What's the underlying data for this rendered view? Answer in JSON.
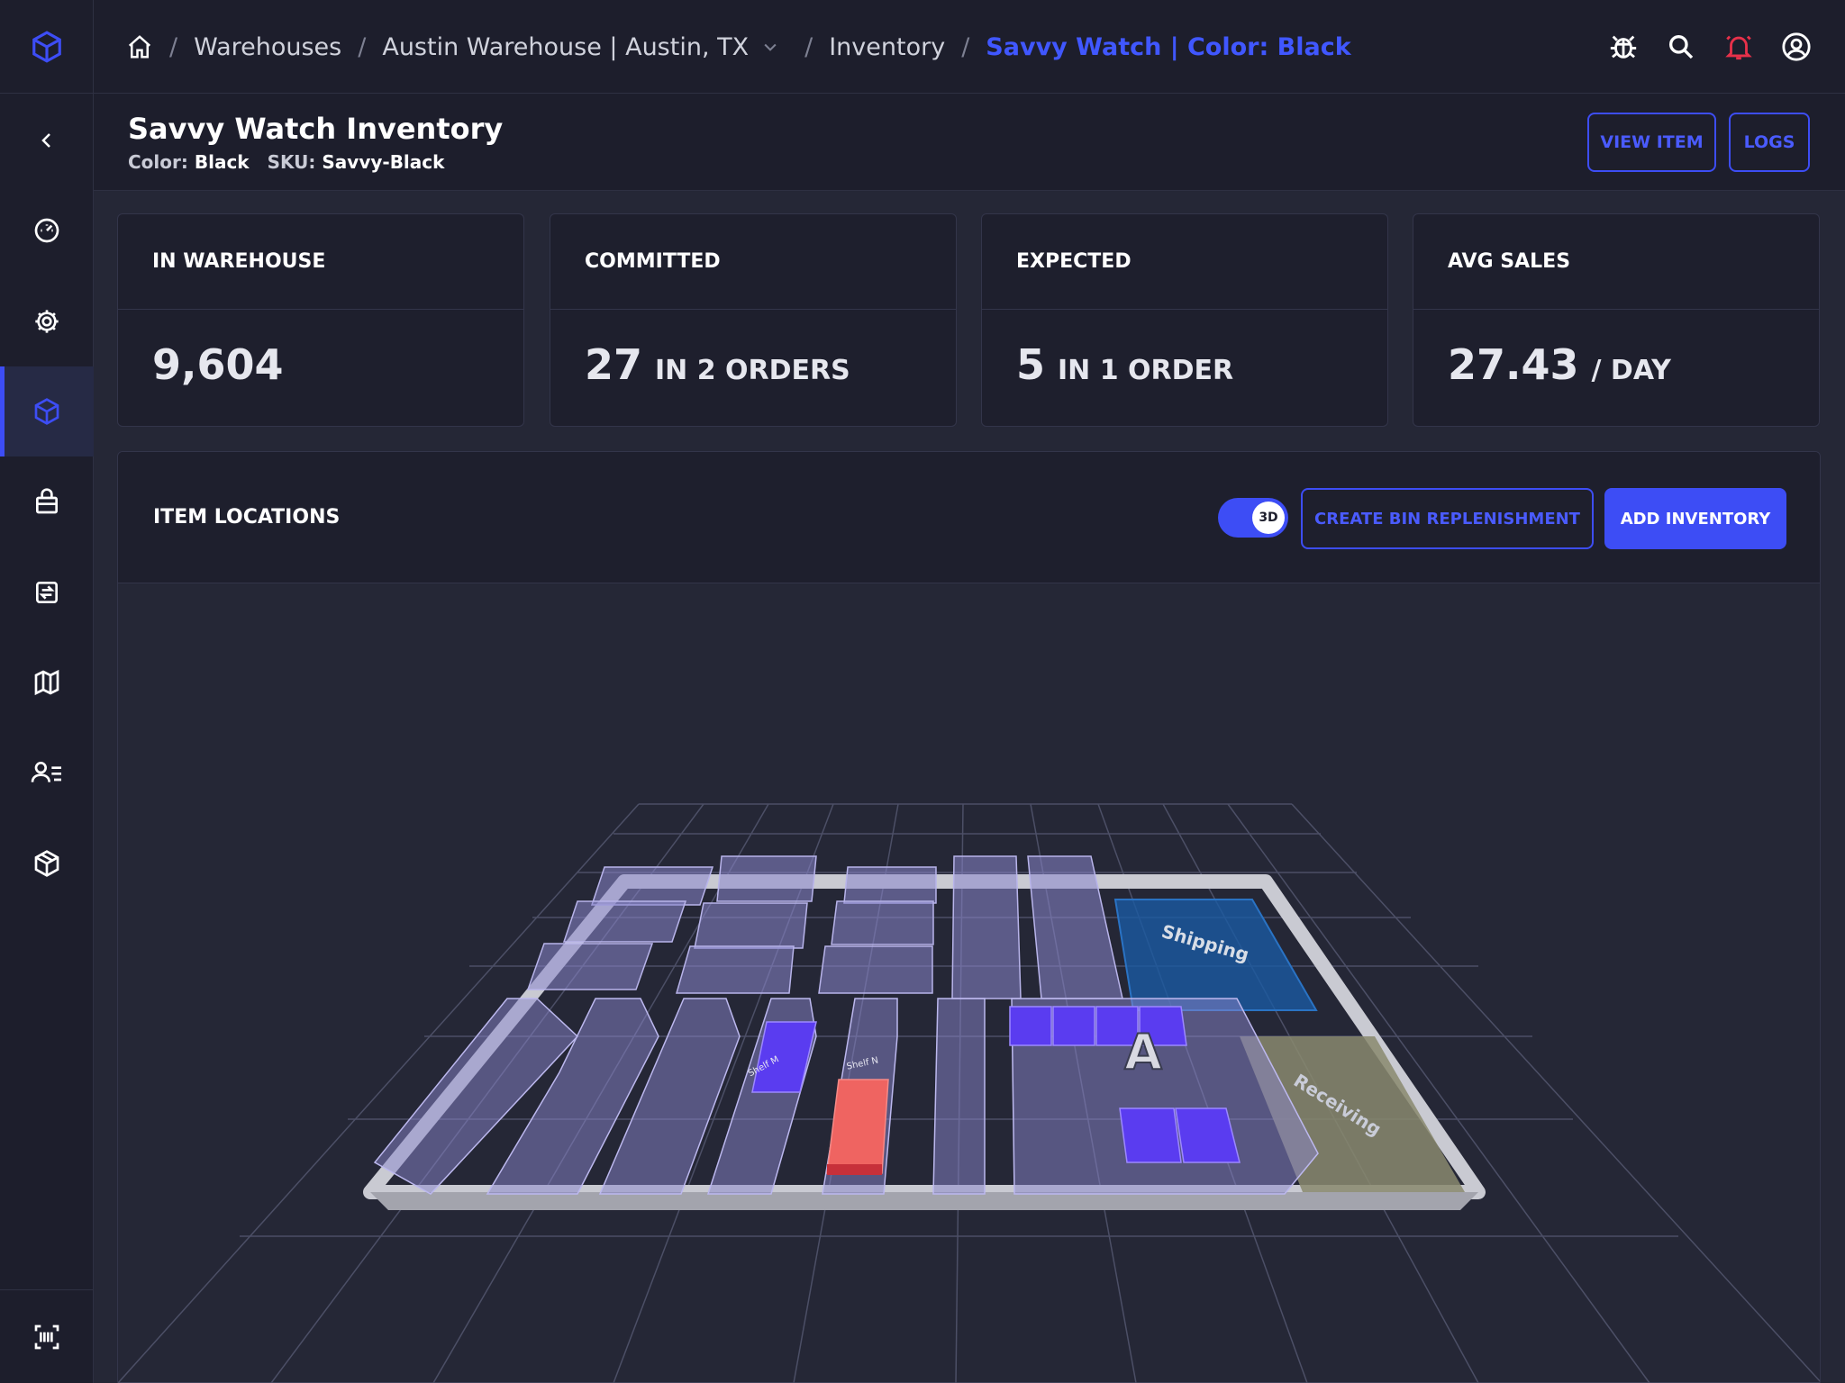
{
  "breadcrumb": {
    "items": [
      "Warehouses",
      "Austin Warehouse | Austin, TX",
      "Inventory"
    ],
    "current": "Savvy Watch | Color: Black"
  },
  "header": {
    "title": "Savvy Watch Inventory",
    "color_label": "Color:",
    "color_value": "Black",
    "sku_label": "SKU:",
    "sku_value": "Savvy-Black",
    "view_item_label": "VIEW ITEM",
    "logs_label": "LOGS"
  },
  "sidebar": {
    "items": [
      {
        "icon": "chevron-left-icon"
      },
      {
        "icon": "dashboard-gauge-icon"
      },
      {
        "icon": "gear-icon"
      },
      {
        "icon": "box-icon",
        "active": true
      },
      {
        "icon": "bag-icon"
      },
      {
        "icon": "transfer-icon"
      },
      {
        "icon": "map-icon"
      },
      {
        "icon": "user-list-icon"
      },
      {
        "icon": "package-icon"
      }
    ],
    "bottom_icon": "barcode-scan-icon"
  },
  "stats": [
    {
      "label": "IN WAREHOUSE",
      "value": "9,604",
      "unit": ""
    },
    {
      "label": "COMMITTED",
      "value": "27",
      "unit": "IN 2 ORDERS"
    },
    {
      "label": "EXPECTED",
      "value": "5",
      "unit": "IN 1 ORDER"
    },
    {
      "label": "AVG SALES",
      "value": "27.43",
      "unit": "/ DAY"
    }
  ],
  "locations": {
    "title": "ITEM LOCATIONS",
    "toggle_label": "3D",
    "toggle_on": true,
    "create_label": "CREATE BIN REPLENISHMENT",
    "add_label": "ADD INVENTORY",
    "zones": {
      "shipping": "Shipping",
      "receiving": "Receiving",
      "area": "A",
      "shelf_m": "Shelf M",
      "shelf_n": "Shelf N"
    }
  },
  "colors": {
    "accent": "#3d4df5",
    "alert": "#e8314a",
    "highlight_bin": "#ef6461",
    "active_bin": "#5a3cf0"
  }
}
